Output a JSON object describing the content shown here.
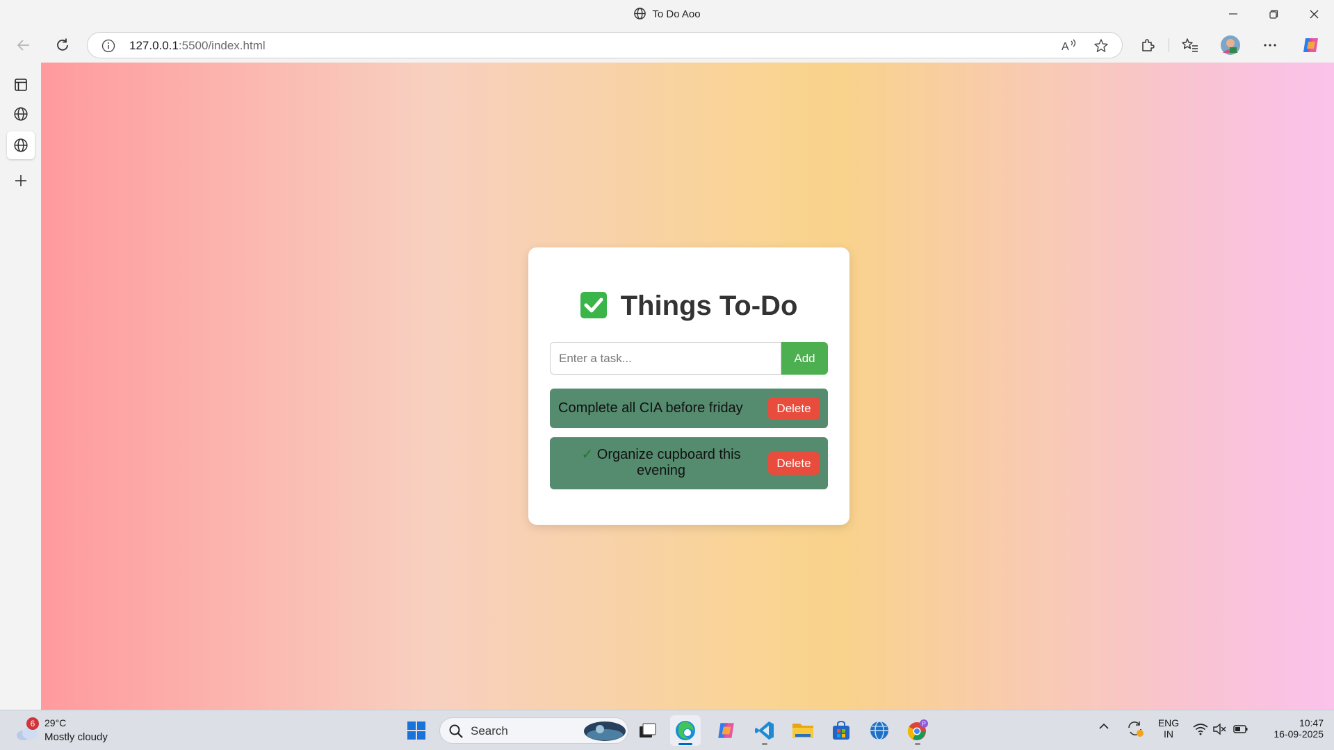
{
  "window": {
    "title": "To Do Aoo",
    "minimize_icon": "minimize-icon",
    "maximize_icon": "restore-icon",
    "close_icon": "close-icon"
  },
  "browser": {
    "url_host": "127.0.0.1",
    "url_rest": ":5500/index.html"
  },
  "app": {
    "heading": "Things To-Do",
    "input_placeholder": "Enter a task...",
    "input_value": "",
    "add_label": "Add",
    "tasks": [
      {
        "text": "Complete all CIA before friday",
        "done": false,
        "delete_label": "Delete"
      },
      {
        "check": "✓",
        "text": "Organize cupboard this evening",
        "done": true,
        "delete_label": "Delete"
      }
    ],
    "colors": {
      "add_button": "#4caf50",
      "task_background": "#558b6e",
      "delete_button": "#e74c3c"
    }
  },
  "taskbar": {
    "weather_badge": "6",
    "weather_temp": "29°C",
    "weather_desc": "Mostly cloudy",
    "search_label": "Search",
    "lang_line1": "ENG",
    "lang_line2": "IN",
    "time": "10:47",
    "date": "16-09-2025"
  }
}
